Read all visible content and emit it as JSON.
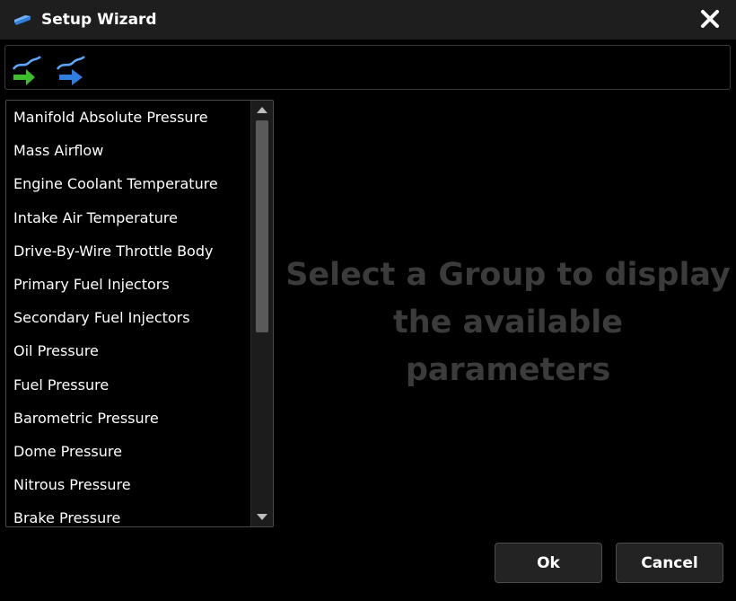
{
  "window": {
    "title": "Setup Wizard"
  },
  "toolbar": {
    "buttons": [
      {
        "icon": "curve-green-arrow-icon"
      },
      {
        "icon": "curve-blue-arrow-icon"
      }
    ]
  },
  "groups": {
    "items": [
      "Manifold Absolute Pressure",
      "Mass Airflow",
      "Engine Coolant Temperature",
      "Intake Air Temperature",
      "Drive-By-Wire Throttle Body",
      "Primary Fuel Injectors",
      "Secondary Fuel Injectors",
      "Oil Pressure",
      "Fuel Pressure",
      "Barometric Pressure",
      "Dome Pressure",
      "Nitrous Pressure",
      "Brake Pressure"
    ]
  },
  "placeholder": {
    "line1": "Select a Group to display",
    "line2": "the available parameters"
  },
  "footer": {
    "ok_label": "Ok",
    "cancel_label": "Cancel"
  },
  "colors": {
    "background": "#000000",
    "titlebar": "#1e1e1e",
    "placeholder_text": "#3b3b3b",
    "button": "#232323",
    "accent_green": "#3bbf2a",
    "accent_blue": "#2f7fe0"
  }
}
